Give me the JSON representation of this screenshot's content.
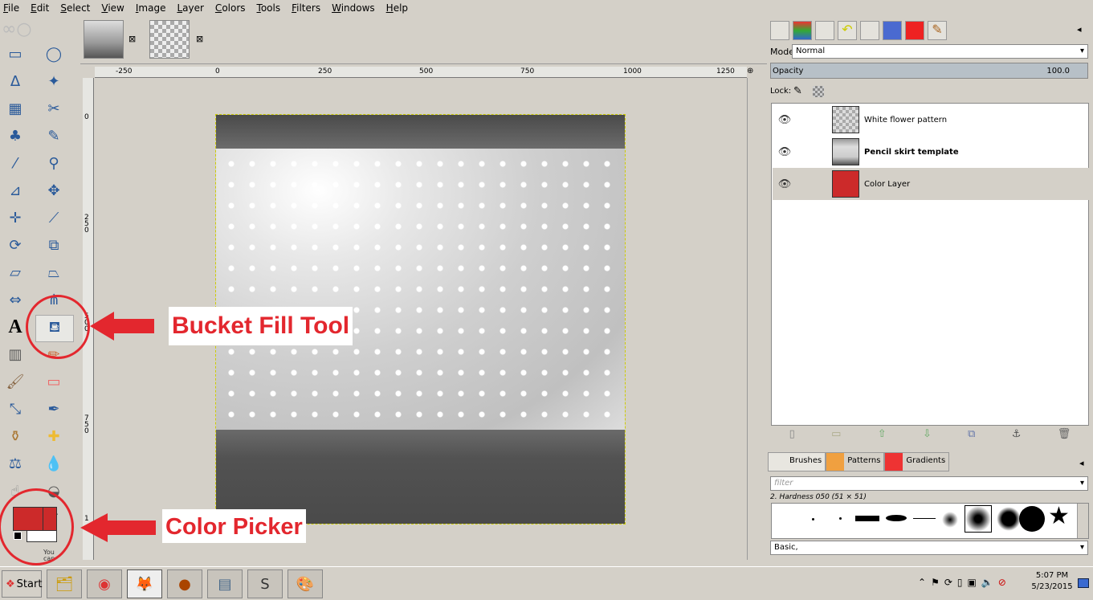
{
  "menu": [
    "File",
    "Edit",
    "Select",
    "View",
    "Image",
    "Layer",
    "Colors",
    "Tools",
    "Filters",
    "Windows",
    "Help"
  ],
  "ruler_h": [
    "-250",
    "0",
    "250",
    "500",
    "750",
    "1000",
    "1250"
  ],
  "ruler_v": [
    "0",
    "2\n5\n0",
    "5\n0\n0",
    "7\n5\n0",
    "1"
  ],
  "layers_panel": {
    "mode_label": "Mode:",
    "mode_value": "Normal",
    "opacity_label": "Opacity",
    "opacity_value": "100.0",
    "lock_label": "Lock:",
    "layers": [
      {
        "name": "White flower pattern",
        "bold": false,
        "selected": false
      },
      {
        "name": "Pencil skirt template",
        "bold": true,
        "selected": false
      },
      {
        "name": "Color Layer",
        "bold": false,
        "selected": true
      }
    ]
  },
  "brushes_panel": {
    "tabs": [
      "Brushes",
      "Patterns",
      "Gradients"
    ],
    "filter_placeholder": "filter",
    "brush_name": "2. Hardness 050 (51 × 51)",
    "tag_value": "Basic,"
  },
  "annotations": {
    "bucket": "Bucket Fill Tool",
    "picker": "Color Picker"
  },
  "toolbox": {
    "hint": "You\ncan"
  },
  "taskbar": {
    "start": "Start",
    "time": "5:07 PM",
    "date": "5/23/2015"
  },
  "colors": {
    "foreground": "#cc2a2a",
    "background": "#ffffff",
    "callout": "#e3272e"
  }
}
